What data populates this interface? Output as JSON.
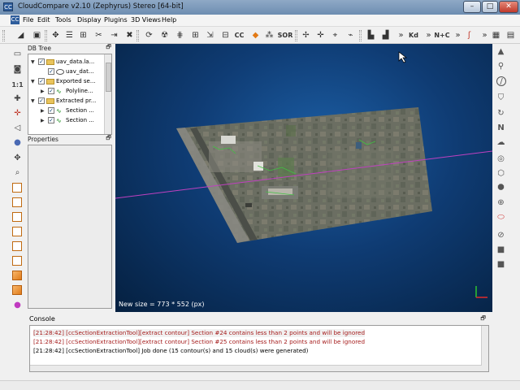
{
  "window": {
    "title": "CloudCompare v2.10 (Zephyrus) Stereo [64-bit]",
    "app_icon": "CC",
    "minimize": "–",
    "maximize": "□",
    "close": "✕"
  },
  "menu": {
    "items": [
      "File",
      "Edit",
      "Tools",
      "Display",
      "Plugins",
      "3D Views",
      "Help"
    ]
  },
  "toolbar": {
    "sor_label": "SOR",
    "kd_label": "Kd",
    "nc_label": "N+C",
    "cc_label": "CC",
    "more": "»"
  },
  "db_tree": {
    "title": "DB Tree",
    "float": "🗗",
    "items": [
      {
        "label": "uav_data.la...",
        "icon": "folder-icon",
        "level": 0,
        "checked": true,
        "expand": "▼"
      },
      {
        "label": "uav_dat...",
        "icon": "cloud-icon",
        "level": 1,
        "checked": true,
        "expand": ""
      },
      {
        "label": "Exported se...",
        "icon": "folder-icon",
        "level": 0,
        "checked": true,
        "expand": "▼"
      },
      {
        "label": "Polyline...",
        "icon": "polyline-icon",
        "level": 1,
        "checked": true,
        "expand": "▶"
      },
      {
        "label": "Extracted pr...",
        "icon": "folder-icon",
        "level": 0,
        "checked": true,
        "expand": "▼"
      },
      {
        "label": "Section ...",
        "icon": "polyline-icon",
        "level": 1,
        "checked": true,
        "expand": "▶"
      },
      {
        "label": "Section ...",
        "icon": "polyline-icon",
        "level": 1,
        "checked": true,
        "expand": "▶"
      }
    ]
  },
  "properties": {
    "title": "Properties",
    "float": "🗗"
  },
  "viewport": {
    "status_message": "New size = 773 * 552 (px)",
    "background_color": "#0f3c74",
    "section_line_color": "#c040c0"
  },
  "console": {
    "title": "Console",
    "float": "🗗",
    "lines": [
      {
        "text": "[21:28:42] [ccSectionExtractionTool][extract contour] Section #24 contains less than 2 points and will be ignored",
        "type": "warning"
      },
      {
        "text": "[21:28:42] [ccSectionExtractionTool][extract contour] Section #25 contains less than 2 points and will be ignored",
        "type": "warning"
      },
      {
        "text": "[21:28:42] [ccSectionExtractionTool] Job done (15 contour(s) and 15 cloud(s) were generated)",
        "type": "info"
      }
    ]
  }
}
